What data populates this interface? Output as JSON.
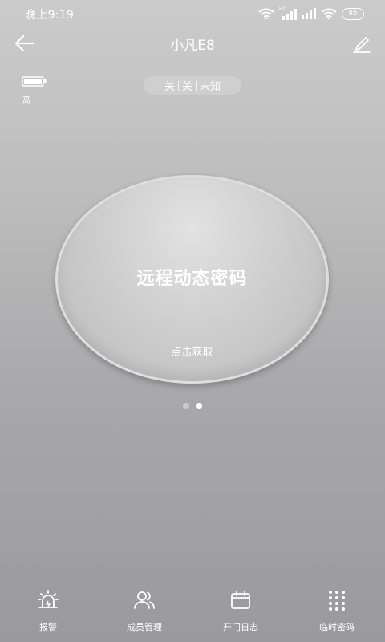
{
  "status_bar": {
    "time": "晚上9:19",
    "network_label": "HD",
    "battery": "95",
    "icons": [
      "wifi-icon",
      "signal-icon",
      "wifi-icon",
      "battery-icon"
    ]
  },
  "header": {
    "title": "小凡E8",
    "back_icon": "arrow-left-icon",
    "edit_icon": "pencil-icon"
  },
  "device_battery": {
    "icon": "battery-icon",
    "level_label": "高"
  },
  "status_chips": [
    "关",
    "关",
    "未知"
  ],
  "main_action": {
    "title": "远程动态密码",
    "action": "点击获取"
  },
  "pager": {
    "pages": 2,
    "active_index": 1
  },
  "bottom_nav": [
    {
      "icon": "alarm-icon",
      "label": "报警"
    },
    {
      "icon": "users-icon",
      "label": "成员管理"
    },
    {
      "icon": "calendar-icon",
      "label": "开门日志"
    },
    {
      "icon": "keypad-icon",
      "label": "临时密码"
    }
  ],
  "colors": {
    "background_top": "#cbcbcb",
    "background_bottom": "#9a9a9c",
    "foreground": "#ffffff"
  }
}
